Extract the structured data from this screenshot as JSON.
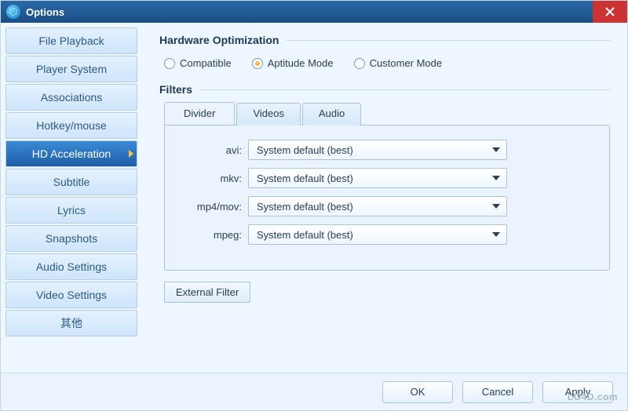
{
  "window": {
    "title": "Options"
  },
  "sidebar": {
    "items": [
      {
        "label": "File Playback"
      },
      {
        "label": "Player System"
      },
      {
        "label": "Associations"
      },
      {
        "label": "Hotkey/mouse"
      },
      {
        "label": "HD Acceleration",
        "active": true
      },
      {
        "label": "Subtitle"
      },
      {
        "label": "Lyrics"
      },
      {
        "label": "Snapshots"
      },
      {
        "label": "Audio Settings"
      },
      {
        "label": "Video Settings"
      },
      {
        "label": "其他"
      }
    ]
  },
  "main": {
    "hw_title": "Hardware Optimization",
    "radios": [
      {
        "label": "Compatible",
        "selected": false
      },
      {
        "label": "Aptitude Mode",
        "selected": true
      },
      {
        "label": "Customer Mode",
        "selected": false
      }
    ],
    "filters_title": "Filters",
    "tabs": [
      {
        "label": "Divider",
        "active": true
      },
      {
        "label": "Videos",
        "active": false
      },
      {
        "label": "Audio",
        "active": false
      }
    ],
    "rows": [
      {
        "label": "avi:",
        "value": "System default (best)"
      },
      {
        "label": "mkv:",
        "value": "System default (best)"
      },
      {
        "label": "mp4/mov:",
        "value": "System default (best)"
      },
      {
        "label": "mpeg:",
        "value": "System default (best)"
      }
    ],
    "external_filter": "External Filter"
  },
  "footer": {
    "ok": "OK",
    "cancel": "Cancel",
    "apply": "Apply"
  },
  "watermark": "LO4D.com"
}
